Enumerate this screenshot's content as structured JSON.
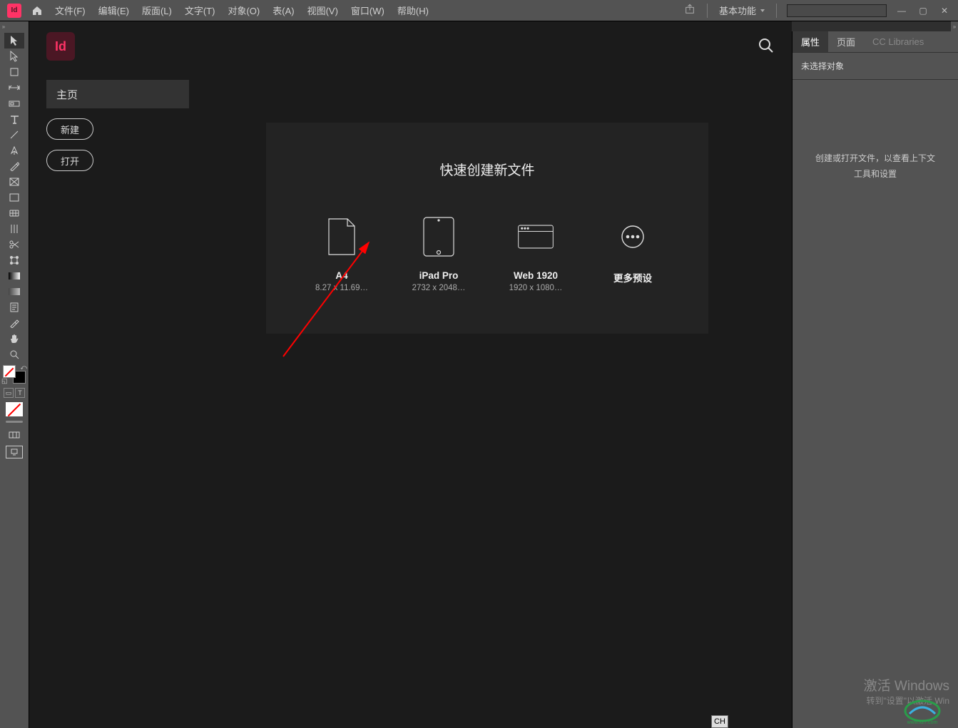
{
  "menubar": {
    "app_initials": "Id",
    "items": [
      "文件(F)",
      "编辑(E)",
      "版面(L)",
      "文字(T)",
      "对象(O)",
      "表(A)",
      "视图(V)",
      "窗口(W)",
      "帮助(H)"
    ],
    "workspace": "基本功能"
  },
  "window_controls": {
    "minimize": "—",
    "maximize": "▢",
    "close": "✕"
  },
  "left_nav": {
    "home_label": "主页",
    "new_label": "新建",
    "open_label": "打开"
  },
  "quick_panel": {
    "title": "快速创建新文件",
    "presets": [
      {
        "name": "A4",
        "dim": "8.27 x 11.69…"
      },
      {
        "name": "iPad Pro",
        "dim": "2732 x 2048…"
      },
      {
        "name": "Web 1920",
        "dim": "1920 x 1080…"
      }
    ],
    "more_label": "更多预设"
  },
  "right_panel": {
    "tabs": [
      "属性",
      "页面",
      "CC Libraries"
    ],
    "no_selection": "未选择对象",
    "hint_line1": "创建或打开文件，以查看上下文",
    "hint_line2": "工具和设置"
  },
  "watermark": {
    "line1": "激活 Windows",
    "line2": "转到\"设置\"以激活 Win"
  },
  "ime": "CH",
  "logo_text": "Id"
}
